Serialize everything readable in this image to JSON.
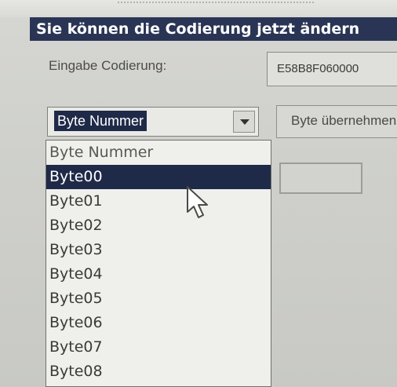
{
  "header": {
    "banner_text": "Sie können die Codierung jetzt ändern"
  },
  "form": {
    "encoding_label": "Eingabe Codierung:",
    "encoding_value": "E58B8F060000",
    "byte_select_value": "Byte Nummer",
    "take_byte_button": "Byte übernehmen"
  },
  "dropdown": {
    "items": [
      "Byte Nummer",
      "Byte00",
      "Byte01",
      "Byte02",
      "Byte03",
      "Byte04",
      "Byte05",
      "Byte06",
      "Byte07",
      "Byte08"
    ],
    "selected_index": 1
  },
  "icons": {
    "combo_arrow": "chevron-down-icon",
    "cursor": "mouse-pointer-icon"
  },
  "colors": {
    "banner_bg": "#2a3555",
    "selection_bg": "#1f2a48",
    "window_bg": "#cfd0cc"
  }
}
